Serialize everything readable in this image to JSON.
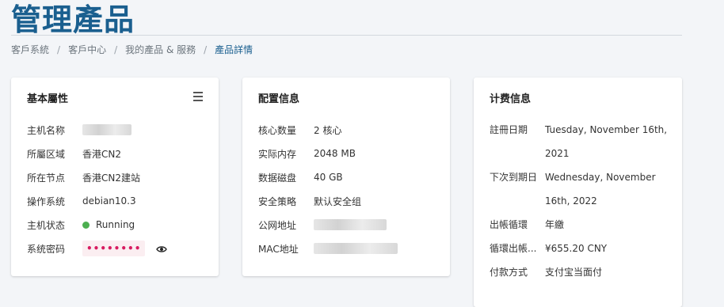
{
  "page": {
    "title": "管理產品"
  },
  "breadcrumb": {
    "items": [
      "客戶系統",
      "客戶中心",
      "我的產品 & 服務"
    ],
    "current": "產品詳情",
    "separator": "/"
  },
  "cards": {
    "basic": {
      "title": "基本屬性",
      "rows": [
        {
          "label": "主机名称",
          "value": ""
        },
        {
          "label": "所屬区域",
          "value": "香港CN2"
        },
        {
          "label": "所在节点",
          "value": "香港CN2建站"
        },
        {
          "label": "操作系统",
          "value": "debian10.3"
        },
        {
          "label": "主机状态",
          "value": "Running"
        },
        {
          "label": "系统密码",
          "value": "••••••••"
        }
      ]
    },
    "config": {
      "title": "配置信息",
      "rows": [
        {
          "label": "核心数量",
          "value": "2 核心"
        },
        {
          "label": "实际内存",
          "value": "2048 MB"
        },
        {
          "label": "数据磁盘",
          "value": "40 GB"
        },
        {
          "label": "安全策略",
          "value": "默认安全组"
        },
        {
          "label": "公网地址",
          "value": ""
        },
        {
          "label": "MAC地址",
          "value": ""
        }
      ]
    },
    "billing": {
      "title": "计费信息",
      "rows": [
        {
          "label": "註冊日期",
          "value": "Tuesday, November 16th, 2021"
        },
        {
          "label": "下次到期日",
          "value": "Wednesday, November 16th, 2022"
        },
        {
          "label": "出帳循環",
          "value": "年繳"
        },
        {
          "label": "循環出帳...",
          "value": "¥655.20 CNY"
        },
        {
          "label": "付款方式",
          "value": "支付宝当面付"
        }
      ]
    }
  },
  "colors": {
    "title": "#1a5f8f",
    "status_running": "#4caf50",
    "password": "#d81b60"
  },
  "icons": {
    "menu": "menu-icon",
    "password_toggle": "eye-icon"
  }
}
